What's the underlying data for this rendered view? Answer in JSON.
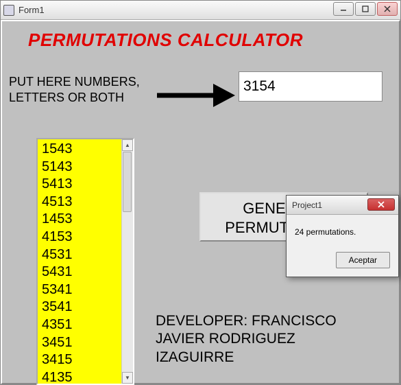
{
  "window": {
    "title": "Form1"
  },
  "heading": "PERMUTATIONS CALCULATOR",
  "instruction": "PUT HERE NUMBERS,\nLETTERS OR BOTH",
  "input": {
    "value": "3154"
  },
  "list": {
    "items": [
      "1543",
      "5143",
      "5413",
      "4513",
      "1453",
      "4153",
      "4531",
      "5431",
      "5341",
      "3541",
      "4351",
      "3451",
      "3415",
      "4135"
    ]
  },
  "generate_btn": "GENERATE\nPERMUTATIONS",
  "developer": "DEVELOPER: FRANCISCO\nJAVIER RODRIGUEZ\nIZAGUIRRE",
  "dialog": {
    "title": "Project1",
    "message": "24 permutations.",
    "accept": "Aceptar"
  }
}
